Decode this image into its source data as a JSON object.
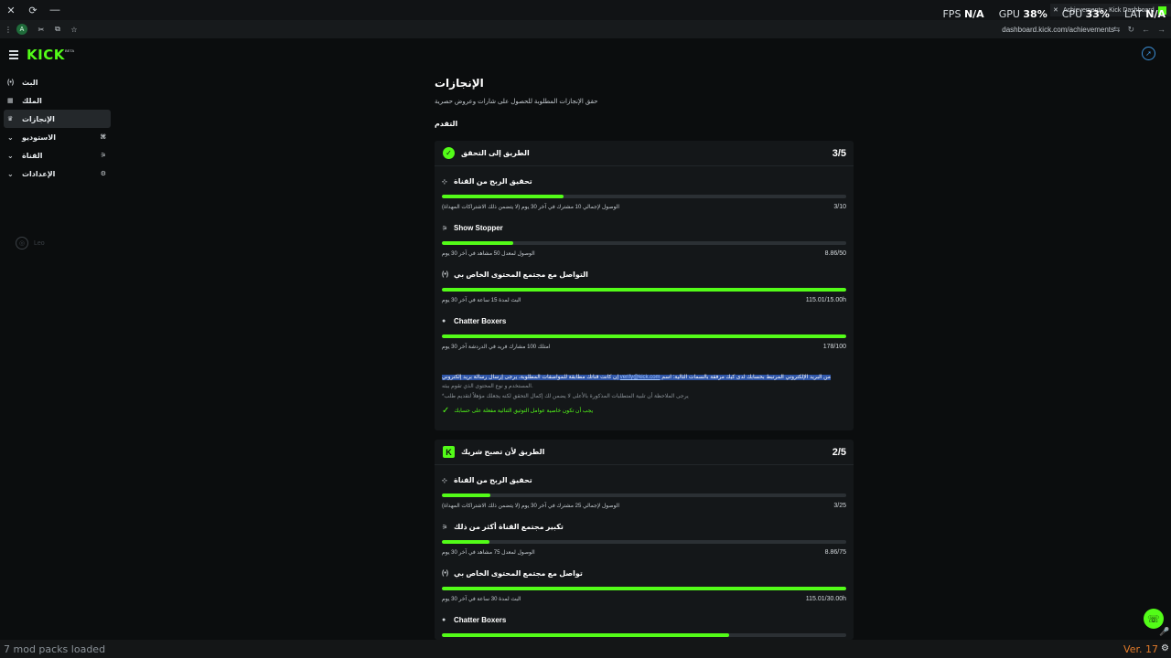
{
  "window": {
    "close_glyph": "✕",
    "reload_glyph": "⟳",
    "min_glyph": "—",
    "tab_title": "Achievements - Kick Dashboard",
    "tab_close": "✕",
    "tab_plus": "+",
    "stats": [
      {
        "label": "FPS",
        "value": "N/A"
      },
      {
        "label": "GPU",
        "value": "38%"
      },
      {
        "label": "CPU",
        "value": "33%"
      },
      {
        "label": "LAT",
        "value": "N/A"
      }
    ]
  },
  "addressbar": {
    "menu_glyph": "⋮",
    "avatar": "A",
    "url": "dashboard.kick.com/achievements"
  },
  "header": {
    "logo": "KICK",
    "beta": "BETA"
  },
  "sidebar": {
    "items": [
      {
        "label": "البث",
        "icon": "(•)"
      },
      {
        "label": "الملك",
        "icon": "▦"
      },
      {
        "label": "الإنجازات",
        "icon": "🏆"
      },
      {
        "label": "الاستوديو",
        "icon": "⌄"
      },
      {
        "label": "القناة",
        "icon": "⌄"
      },
      {
        "label": "الإعدادات",
        "icon": "⌄"
      }
    ],
    "footer_lang": "Leo"
  },
  "page": {
    "title": "الإنجازات",
    "subtitle": "حقق الإنجازات المطلوبة للحصول على شارات وعروض حصرية",
    "section": "التقدم"
  },
  "cards": [
    {
      "title": "الطريق إلى التحقق",
      "score": "3/5",
      "goals": [
        {
          "title": "تحقيق الربح من القناة",
          "desc": "الوصول لإجمالي 10 مشترك في آخر 30 يوم (لا يتضمن ذلك الاشتراكات المهداة)",
          "value": "3/10",
          "progress": 0.3
        },
        {
          "title": "Show Stopper",
          "desc": "الوصول لمعدل 50 مشاهد في آخر 30 يوم",
          "value": "8.86/50",
          "progress": 0.177
        },
        {
          "title": "التواصل مع مجتمع المحتوى الخاص بي",
          "desc": "البث لمدة 15 ساعة في آخر 30 يوم",
          "value": "115.01/15.00h",
          "progress": 1.0
        },
        {
          "title": "Chatter Boxers",
          "desc": "امتلك 100 مشارك فريد في الدردشة آخر 30 يوم",
          "value": "178/100",
          "progress": 1.0
        }
      ],
      "note": {
        "text_a": "إن كانت قناتك مطابقة للمواصفات المطلوبة، يرجى إرسال رسالة بريد إلكتروني",
        "email": "verify@kick.com",
        "text_b": "من البريد الإلكتروني المرتبط بحسابك لدى كيك مرفقة بالسمات التالية: اسم",
        "line2": "المستخدم و نوع المحتوى الذي تقوم ببثه.",
        "line3": "*يرجى الملاحظة أن تلبية المتطلبات المذكورة بالأعلى لا يضمن لك إكمال التحقق لكنه يجعلك مؤهلاً لتقديم طلب",
        "ok": "يجب أن تكون خاصية عوامل التوثيق الثنائية مفعلة على حسابك"
      }
    },
    {
      "title": "الطريق لأن تصبح شريك",
      "score": "2/5",
      "goals": [
        {
          "title": "تحقيق الربح من القناة",
          "desc": "الوصول لإجمالي 25 مشترك في آخر 30 يوم (لا يتضمن ذلك الاشتراكات المهداة)",
          "value": "3/25",
          "progress": 0.12
        },
        {
          "title": "تكبير مجتمع القناة أكثر من ذلك",
          "desc": "الوصول لمعدل 75 مشاهد في آخر 30 يوم",
          "value": "8.86/75",
          "progress": 0.118
        },
        {
          "title": "تواصل مع مجتمع المحتوى الخاص بي",
          "desc": "البث لمدة 30 ساعة في آخر 30 يوم",
          "value": "115.01/30.00h",
          "progress": 1.0
        },
        {
          "title": "Chatter Boxers",
          "desc": "",
          "value": "",
          "progress": 0.71
        }
      ]
    }
  ],
  "bottom": {
    "left": "7 mod packs loaded",
    "right": "Ver. 17"
  },
  "colors": {
    "accent": "#53fc18",
    "background": "#0b0d0e",
    "card": "#141719",
    "selection": "#2e55a8"
  }
}
